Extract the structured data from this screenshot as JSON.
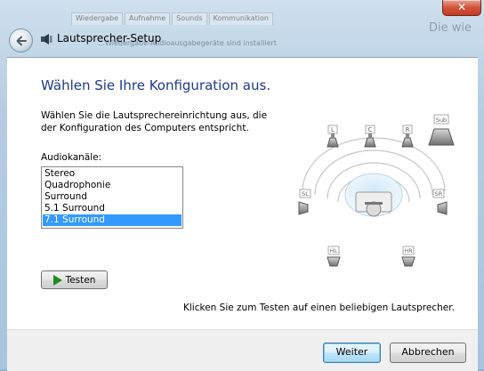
{
  "window": {
    "title": "Lautsprecher-Setup",
    "close_glyph": "✕",
    "background_tabs": [
      "Wiedergabe",
      "Aufnahme",
      "Sounds",
      "Kommunikation"
    ],
    "background_text": "…Wiedergabe-Audioausgabegeräte sind installiert",
    "background_side_text": "Die wie",
    "back_icon": "back-arrow-icon",
    "title_icon": "speaker-setup-icon"
  },
  "main": {
    "heading": "Wählen Sie Ihre Konfiguration aus.",
    "description": "Wählen Sie die Lautsprechereinrichtung aus, die der Konfiguration des Computers entspricht.",
    "channels_label": "Audiokanäle:",
    "channels": [
      "Stereo",
      "Quadrophonie",
      "Surround",
      "5.1 Surround",
      "7.1 Surround"
    ],
    "selected_channel": "7.1 Surround",
    "test_button": "Testen",
    "hint": "Klicken Sie zum Testen auf einen beliebigen Lautsprecher."
  },
  "speakers": [
    {
      "label": "L",
      "icon": "speaker-icon"
    },
    {
      "label": "C",
      "icon": "speaker-icon"
    },
    {
      "label": "R",
      "icon": "speaker-icon"
    },
    {
      "label": "Sub",
      "icon": "subwoofer-icon"
    },
    {
      "label": "SL",
      "icon": "speaker-icon"
    },
    {
      "label": "SR",
      "icon": "speaker-icon"
    },
    {
      "label": "HL",
      "icon": "speaker-icon"
    },
    {
      "label": "HR",
      "icon": "speaker-icon"
    }
  ],
  "footer": {
    "next_button": "Weiter",
    "cancel_button": "Abbrechen"
  }
}
